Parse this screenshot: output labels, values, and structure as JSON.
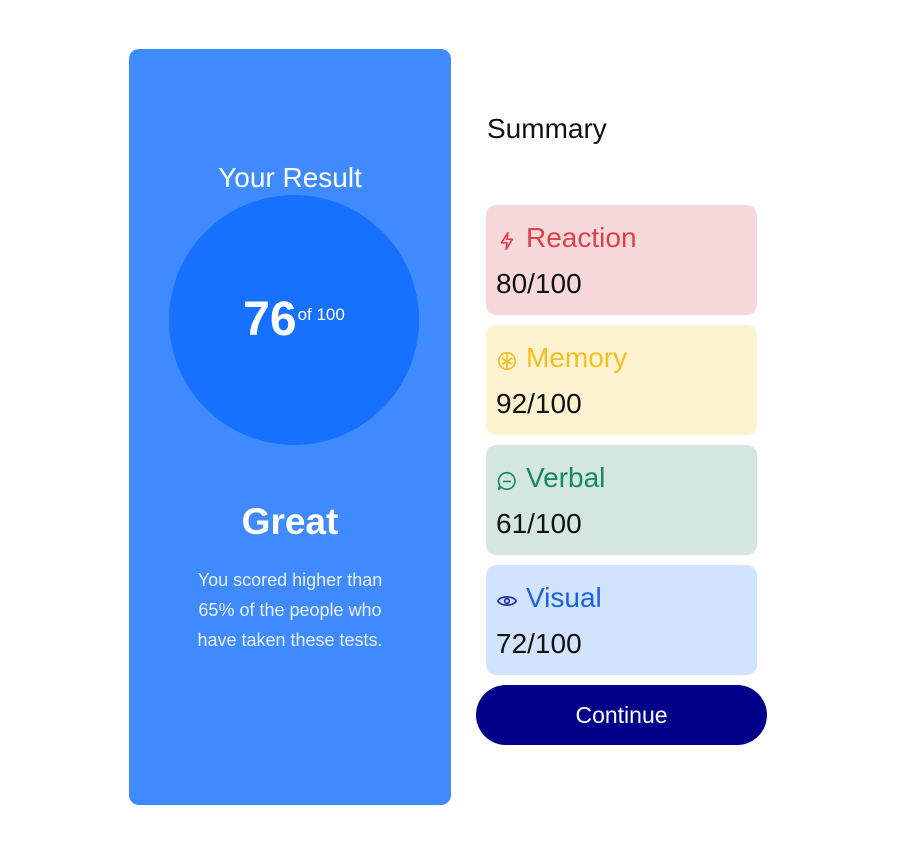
{
  "result": {
    "title": "Your Result",
    "score": "76",
    "score_of": "of 100",
    "rating": "Great",
    "description": "You scored higher than 65% of the people who have taken these tests."
  },
  "summary": {
    "title": "Summary",
    "items": [
      {
        "label": "Reaction",
        "score": "80/100",
        "icon": "lightning-icon",
        "color": "#e0404a",
        "bg": "#f7d8db"
      },
      {
        "label": "Memory",
        "score": "92/100",
        "icon": "brain-icon",
        "color": "#f5be21",
        "bg": "#fef3d1"
      },
      {
        "label": "Verbal",
        "score": "61/100",
        "icon": "chat-bubble-icon",
        "color": "#17895f",
        "bg": "#d3e7de"
      },
      {
        "label": "Visual",
        "score": "72/100",
        "icon": "eye-icon",
        "color": "#1a63e0",
        "bg": "#d2e3fd"
      }
    ]
  },
  "continue_label": "Continue",
  "colors": {
    "card_bg": "#3f8bfd",
    "circle_bg": "#1672fe",
    "button_bg": "#000088"
  }
}
